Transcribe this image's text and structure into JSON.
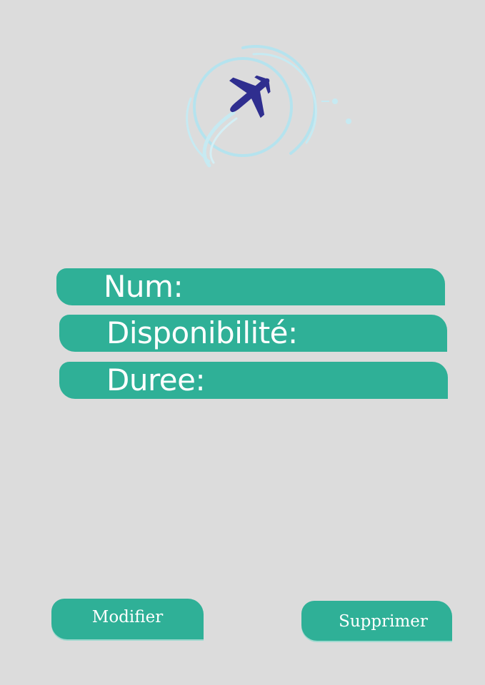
{
  "logo": {
    "icon": "airplane-logo-icon",
    "plane_color": "#2f2e8f",
    "ring_color": "#b5e3ee"
  },
  "fields": [
    {
      "label": "Num:"
    },
    {
      "label": "Disponibilité:"
    },
    {
      "label": "Duree:"
    }
  ],
  "buttons": {
    "modifier_label": "Modifier",
    "supprimer_label": "Supprimer"
  },
  "colors": {
    "accent": "#2fb097",
    "background": "#dcdcdc"
  }
}
